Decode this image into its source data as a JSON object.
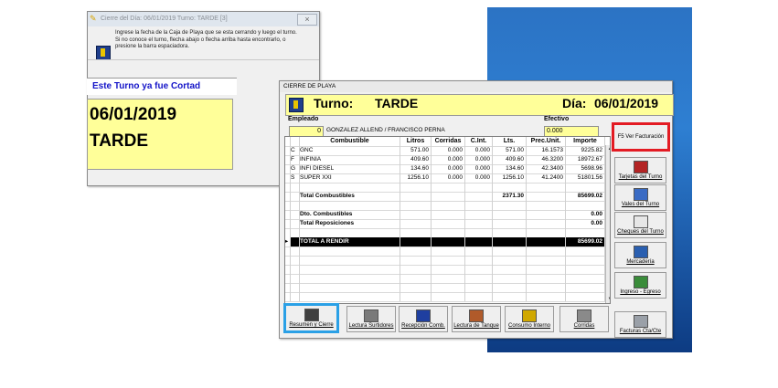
{
  "back_window": {
    "title": "Cierre del Día:  06/01/2019    Turno:  TARDE          [3]",
    "close_label": "×",
    "message": "Ingrese la fecha de la Caja de Playa que se esta cerrando y luego el turno. Si no conoce el turno,  flecha abajo o flecha arriba hasta encontrarlo, o presione la barra espaciadora.",
    "banner": "Este Turno ya fue Cortad",
    "date": "06/01/2019",
    "shift": "TARDE"
  },
  "main_window": {
    "title": "CIERRE DE PLAYA",
    "turno_label": "Turno:",
    "turno_value": "TARDE",
    "dia_label": "Día:",
    "dia_value": "06/01/2019",
    "empleado_label": "Empleado",
    "empleado_id": "0",
    "empleado_name": "GONZALEZ ALLEND / FRANCISCO PERNA",
    "efectivo_label": "Efectivo",
    "efectivo_value": "0.000"
  },
  "table": {
    "columns": [
      "Combustible",
      "Litros",
      "Corridas",
      "C.Int.",
      "Lts.",
      "Prec.Unit.",
      "Importe"
    ],
    "rows": [
      {
        "code": "C",
        "name": "GNC",
        "litros": "571.00",
        "corridas": "0.000",
        "cint": "0.000",
        "lts": "571.00",
        "prec": "16.1573",
        "importe": "9225.82"
      },
      {
        "code": "F",
        "name": "INFINIA",
        "litros": "409.60",
        "corridas": "0.000",
        "cint": "0.000",
        "lts": "409.60",
        "prec": "46.3200",
        "importe": "18972.67"
      },
      {
        "code": "G",
        "name": "INFI DIESEL",
        "litros": "134.60",
        "corridas": "0.000",
        "cint": "0.000",
        "lts": "134.60",
        "prec": "42.3400",
        "importe": "5698.96"
      },
      {
        "code": "S",
        "name": "SUPER XXI",
        "litros": "1256.10",
        "corridas": "0.000",
        "cint": "0.000",
        "lts": "1256.10",
        "prec": "41.2400",
        "importe": "51801.56"
      }
    ],
    "total_combustibles_label": "Total Combustibles",
    "total_combustibles_lts": "2371.30",
    "total_combustibles_importe": "85699.02",
    "dto_label": "Dto. Combustibles",
    "dto_value": "0.00",
    "repos_label": "Total Reposiciones",
    "repos_value": "0.00",
    "rendir_label": "TOTAL A RENDIR",
    "rendir_value": "85699.02",
    "row_marker": "▸",
    "scroll_up": "▲",
    "scroll_down": "▼"
  },
  "side_buttons": [
    {
      "label": "F5 Ver Facturación",
      "icon": "invoice-icon"
    },
    {
      "label": "Tarjetas del Turno",
      "icon": "card-icon"
    },
    {
      "label": "Vales del Turno",
      "icon": "voucher-icon"
    },
    {
      "label": "Cheques del Turno",
      "icon": "check-icon"
    },
    {
      "label": "Mercadería",
      "icon": "cart-icon"
    },
    {
      "label": "Ingreso - Egreso",
      "icon": "money-icon"
    },
    {
      "label": "Facturas Cta/Cte",
      "icon": "calculator-icon"
    }
  ],
  "bottom_buttons": [
    {
      "label": "Resumen y Cierre",
      "icon": "summary-icon"
    },
    {
      "label": "Lectura Surtidores",
      "icon": "pump-icon"
    },
    {
      "label": "Recepción Comb.",
      "icon": "truck-icon"
    },
    {
      "label": "Lectura de Tanque",
      "icon": "tank-icon"
    },
    {
      "label": "Consumo Interno",
      "icon": "vehicle-icon"
    },
    {
      "label": "Corridas",
      "icon": "fuel-icon"
    }
  ],
  "colors": {
    "accent_yellow": "#ffff99",
    "highlight_red": "#e31b23",
    "highlight_blue": "#2aa0e6",
    "banner_blue": "#1414c8",
    "desktop_blue": "#2c73c4"
  }
}
